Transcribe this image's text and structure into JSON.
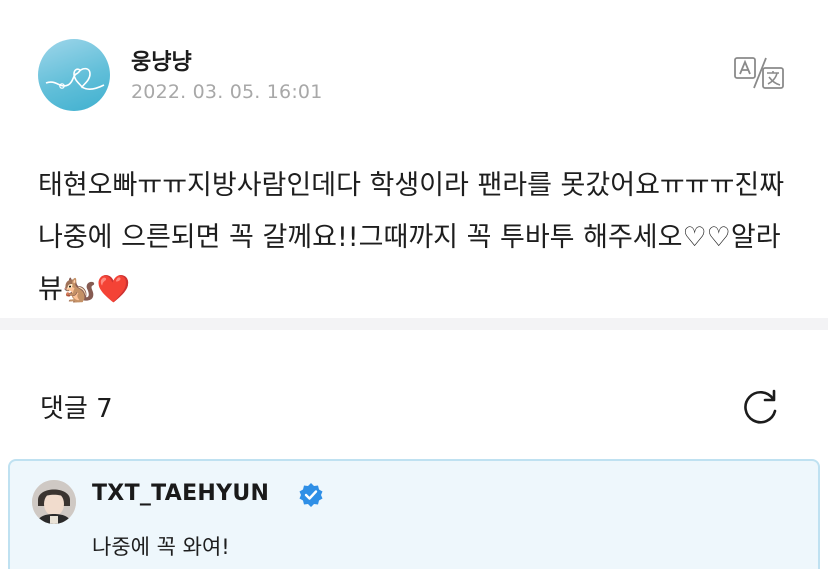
{
  "post": {
    "author": "웅냥냥",
    "date": "2022. 03. 05. 16:01",
    "body": "태현오빠ㅠㅠ지방사람인데다 학생이라 팬라를 못갔어요ㅠㅠㅠ진짜 나중에 으른되면 꼭 갈께요!!그때까지 꼭 투바투 해주세오♡♡알라뷰🐿️❤️"
  },
  "icons": {
    "translate": "translate-icon",
    "refresh": "refresh-icon",
    "verified": "verified-badge-icon"
  },
  "comments": {
    "header": "댓글 7",
    "items": [
      {
        "author": "TXT_TAEHYUN",
        "verified": true,
        "text": "나중에 꼭 와여!"
      }
    ]
  },
  "colors": {
    "date": "#a8a8a8",
    "divider": "#f3f3f5",
    "comment_bg": "#eef7fc",
    "comment_border": "#bfe1f1",
    "verified": "#2f8fe6"
  }
}
